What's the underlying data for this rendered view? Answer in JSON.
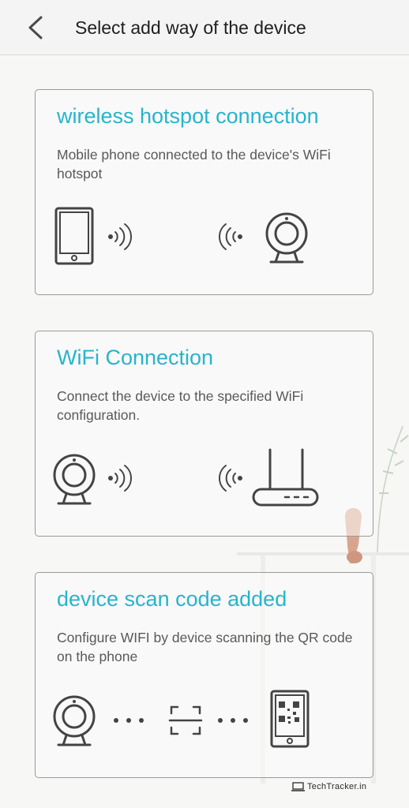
{
  "header": {
    "title": "Select add way of the device",
    "back_icon": "chevron-left-icon"
  },
  "options": [
    {
      "title": "wireless hotspot connection",
      "description": "Mobile phone connected to the device's WiFi hotspot",
      "icons": [
        "phone-icon",
        "signal-right-icon",
        "signal-left-icon",
        "camera-icon"
      ]
    },
    {
      "title": "WiFi Connection",
      "description": "Connect the device to the specified WiFi configuration.",
      "icons": [
        "camera-icon",
        "signal-right-icon",
        "signal-left-icon",
        "router-icon"
      ]
    },
    {
      "title": "device scan code added",
      "description": "Configure WIFI by device scanning the QR code on the phone",
      "icons": [
        "camera-icon",
        "dots-icon",
        "scan-frame-icon",
        "dots-icon",
        "phone-qr-icon"
      ]
    }
  ],
  "colors": {
    "accent": "#27b4cc",
    "icon_stroke": "#444444",
    "card_border": "#9a9a9a"
  },
  "watermark": {
    "text": "TechTracker.in"
  }
}
